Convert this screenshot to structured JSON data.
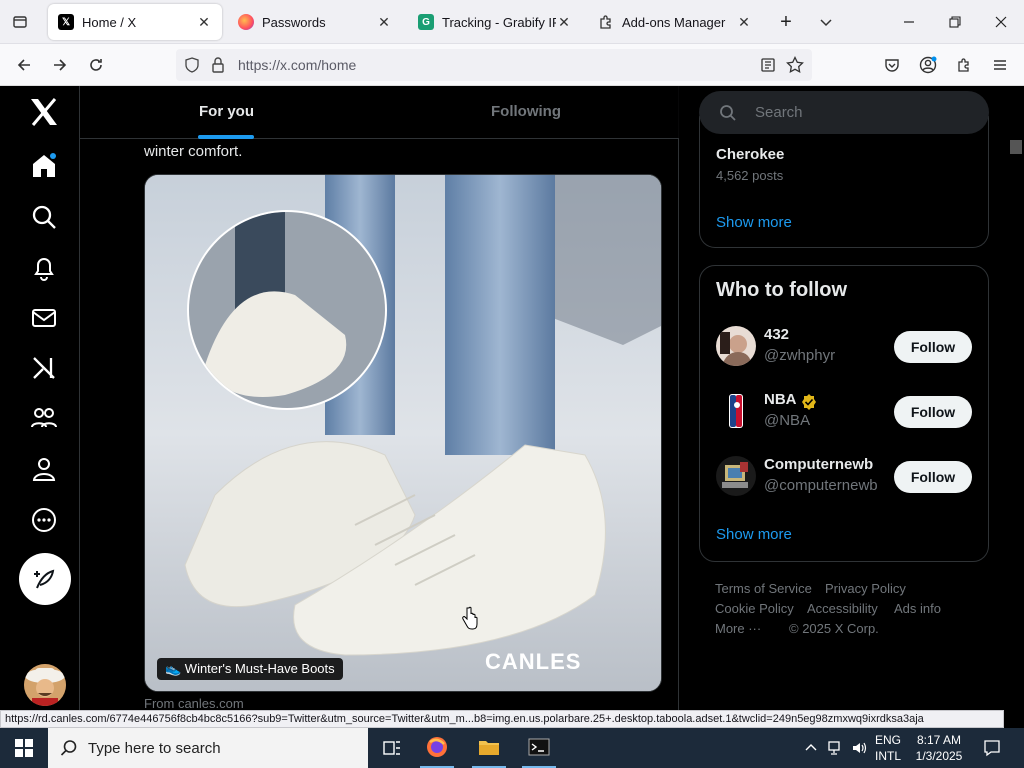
{
  "browser": {
    "tabs": [
      {
        "title": "Home / X",
        "favicon": "X"
      },
      {
        "title": "Passwords",
        "favicon": "firefox"
      },
      {
        "title": "Tracking - Grabify IP Lo",
        "favicon": "G"
      },
      {
        "title": "Add-ons Manager",
        "favicon": "puzzle"
      }
    ],
    "url": "https://x.com/home",
    "status_url": "https://rd.canles.com/6774e446756f8cb4bc8c5166?sub9=Twitter&utm_source=Twitter&utm_m...b8=img.en.us.polarbare.25+.desktop.taboola.adset.1&twclid=249n5eg98zmxwq9ixrdksa3aja"
  },
  "feed": {
    "tabs": [
      "For you",
      "Following"
    ],
    "post_text": "winter comfort.",
    "media_caption": "👟 Winter's Must-Have Boots",
    "brand": "CANLES",
    "from_source": "From canles.com"
  },
  "sidebar": {
    "search_placeholder": "Search",
    "trend": {
      "name": "Cherokee",
      "posts": "4,562 posts"
    },
    "show_more": "Show more",
    "who_to_follow": {
      "title": "Who to follow",
      "accounts": [
        {
          "name": "432",
          "handle": "@zwhphyr",
          "verified": false
        },
        {
          "name": "NBA",
          "handle": "@NBA",
          "verified": true
        },
        {
          "name": "Computernewb",
          "handle": "@computernewb",
          "verified": false
        }
      ],
      "follow_label": "Follow",
      "show_more": "Show more"
    },
    "footer": {
      "terms": "Terms of Service",
      "privacy": "Privacy Policy",
      "cookie": "Cookie Policy",
      "accessibility": "Accessibility",
      "ads": "Ads info",
      "more": "More ···",
      "copyright": "© 2025 X Corp."
    }
  },
  "taskbar": {
    "search_placeholder": "Type here to search",
    "lang_top": "ENG",
    "lang_bottom": "INTL",
    "time": "8:17 AM",
    "date": "1/3/2025"
  },
  "colors": {
    "accent": "#1d9bf0",
    "background": "#000000",
    "border": "#2f3336",
    "text_secondary": "#71767b"
  }
}
